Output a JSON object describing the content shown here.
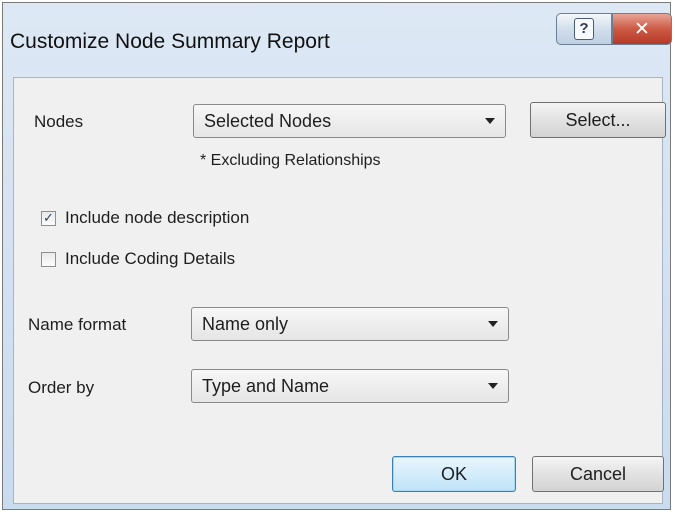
{
  "window": {
    "title": "Customize Node Summary Report",
    "help_glyph": "?",
    "close_glyph": "✕"
  },
  "nodes": {
    "label": "Nodes",
    "selected": "Selected Nodes",
    "select_button": "Select...",
    "note": "* Excluding Relationships"
  },
  "options": {
    "include_description": {
      "label": "Include node description",
      "checked": true,
      "mark": "✓"
    },
    "include_coding": {
      "label": "Include Coding Details",
      "checked": false,
      "mark": ""
    }
  },
  "name_format": {
    "label": "Name format",
    "selected": "Name only"
  },
  "order_by": {
    "label": "Order by",
    "selected": "Type and Name"
  },
  "footer": {
    "ok": "OK",
    "cancel": "Cancel"
  },
  "icons": {
    "help": "help-icon",
    "close": "close-icon",
    "dropdown": "chevron-down-icon",
    "check": "checkmark-icon"
  },
  "colors": {
    "title_bar": "#c9dbef",
    "close_button": "#cc5a45",
    "default_button": "#d4edfb",
    "dialog_body": "#f0f0f0"
  }
}
